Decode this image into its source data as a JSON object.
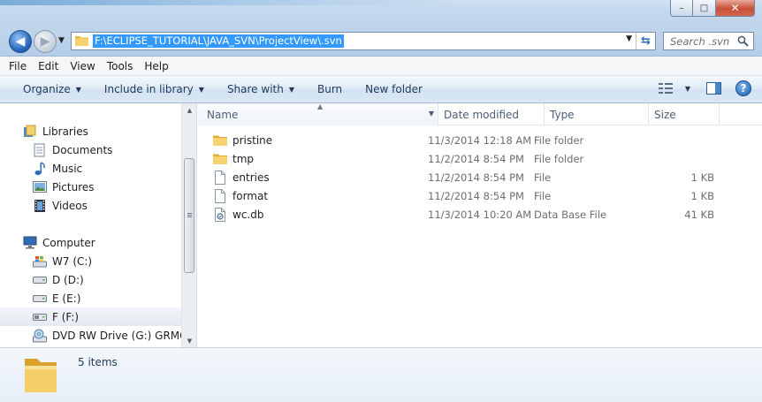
{
  "window": {
    "minimize_glyph": "–",
    "maximize_glyph": "□",
    "close_glyph": "✕"
  },
  "address_bar": {
    "path": "F:\\ECLIPSE_TUTORIAL\\JAVA_SVN\\ProjectView\\.svn",
    "icon": "folder-icon"
  },
  "search": {
    "placeholder": "Search .svn",
    "icon": "magnifier-icon"
  },
  "menubar": {
    "items": [
      "File",
      "Edit",
      "View",
      "Tools",
      "Help"
    ]
  },
  "toolbar": {
    "organize": "Organize",
    "include_in_library": "Include in library",
    "share_with": "Share with",
    "burn": "Burn",
    "new_folder": "New folder",
    "help": "?"
  },
  "nav_pane": {
    "items": [
      {
        "label": "Libraries",
        "icon": "libraries-icon",
        "level": 0
      },
      {
        "label": "Documents",
        "icon": "documents-icon",
        "level": 1
      },
      {
        "label": "Music",
        "icon": "music-icon",
        "level": 1
      },
      {
        "label": "Pictures",
        "icon": "pictures-icon",
        "level": 1
      },
      {
        "label": "Videos",
        "icon": "videos-icon",
        "level": 1
      },
      {
        "label": "Computer",
        "icon": "computer-icon",
        "level": 0
      },
      {
        "label": "W7 (C:)",
        "icon": "windows-drive-icon",
        "level": 1
      },
      {
        "label": "D (D:)",
        "icon": "drive-icon",
        "level": 1
      },
      {
        "label": "E (E:)",
        "icon": "drive-icon",
        "level": 1
      },
      {
        "label": "F (F:)",
        "icon": "usb-drive-icon",
        "level": 1,
        "selected": true
      },
      {
        "label": "DVD RW Drive (G:) GRMCUL",
        "icon": "dvd-drive-icon",
        "level": 1
      }
    ]
  },
  "columns": {
    "name": "Name",
    "date_modified": "Date modified",
    "type": "Type",
    "size": "Size"
  },
  "files": [
    {
      "name": "pristine",
      "date": "11/3/2014 12:18 AM",
      "type": "File folder",
      "size": "",
      "icon": "folder-icon"
    },
    {
      "name": "tmp",
      "date": "11/2/2014 8:54 PM",
      "type": "File folder",
      "size": "",
      "icon": "folder-icon"
    },
    {
      "name": "entries",
      "date": "11/2/2014 8:54 PM",
      "type": "File",
      "size": "1 KB",
      "icon": "file-icon"
    },
    {
      "name": "format",
      "date": "11/2/2014 8:54 PM",
      "type": "File",
      "size": "1 KB",
      "icon": "file-icon"
    },
    {
      "name": "wc.db",
      "date": "11/3/2014 10:20 AM",
      "type": "Data Base File",
      "size": "41 KB",
      "icon": "database-file-icon"
    }
  ],
  "details": {
    "item_count": "5 items"
  },
  "colors": {
    "selection": "#3399ff",
    "folder_yellow": "#f1c24e",
    "toolbar_text": "#1e395b"
  }
}
